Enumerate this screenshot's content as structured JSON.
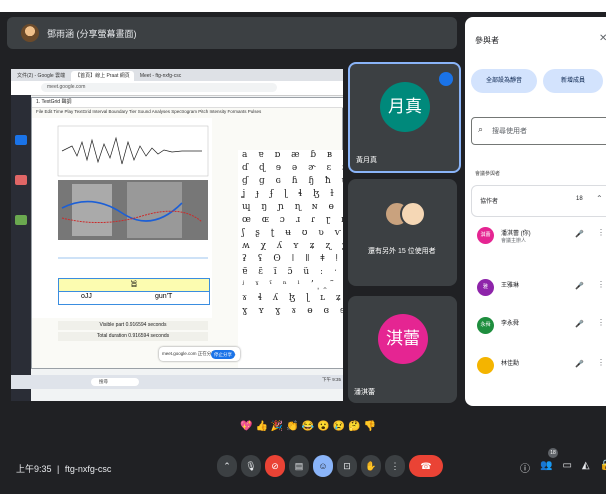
{
  "presenter": {
    "name": "鄧雨涵 (分享螢幕畫面)"
  },
  "shared_screen": {
    "browser_tabs": [
      "文件(2) - Google 雲端",
      "【首頁】線上 Praat 網頁",
      "Meet - ftg-nxfg-csc"
    ],
    "url": "meet.google.com",
    "praat_title": "1. TextGrid 聲調",
    "praat_menu": "File Edit Time Play TextGrid Interval Boundary Tier Sound Analyses Spectrogram Pitch Intensity Formants Pulses",
    "tier1_text": "旨",
    "tier2_left": "oJJ",
    "tier2_right": "gun'T",
    "visible_part": "Visible part 0.916594 seconds",
    "total_duration": "Total duration 0.916594 seconds",
    "ipa_rows": [
      "a ɐ ɒ æ ɓ ʙ ç ɕ ð",
      "ɗ ɖ ɘ ə ɚ ɛ ɜ ɟ ʄ",
      "ɠ ɡ ɢ ɦ ɧ ħ ɥ ɪ ɨ",
      "ʝ ɟ ʄ ɭ ɬ ɮ ɫ ɱ ɯ",
      "ɰ ŋ ɲ ɳ ɴ ɵ ø ɸ θ",
      "œ ɶ ɔ ɹ ɾ ɽ ʀ ʁ ɻ",
      "ʃ ʂ ʈ ʉ ʊ ʋ ⱱ ʌ ɣ",
      "ʍ χ ʎ ʏ ʑ ʐ ʒ ʔ ʕ",
      "ʡ ʢ ʘ ǀ ǁ ǂ ǃ ˈ ˌ",
      "ɐ̃ ɛ̃ ĩ ɔ̃ ũ ː ˑ ʰ ʷ",
      "ʲ ˠ ˤ ⁿ ˡ ʼ ̩ ̯ ̃",
      "ɤ ɬ ʎ ɮ ɭ ʟ ʑ ʐ ʒ",
      "ɣ ʏ ɣ ɤ ɵ ɞ ɘ ɕ ɟ"
    ],
    "share_notice": "meet.google.com 正在分享你的畫面。",
    "stop_share_label": "停止分享",
    "taskbar_search": "搜尋",
    "taskbar_time": "下午 9:35"
  },
  "tiles": [
    {
      "name": "黃月真",
      "avatar_text": "月真",
      "avatar_color": "#00897b"
    },
    {
      "name": "還有另外 15 位使用者"
    },
    {
      "name": "潘淇蕾",
      "avatar_text": "淇蕾",
      "avatar_color": "#e52592"
    }
  ],
  "panel": {
    "title": "參與者",
    "close_icon": "✕",
    "mute_all_label": "全部設為靜音",
    "add_people_label": "新增成員",
    "search_placeholder": "搜尋使用者",
    "in_meeting_label": "會議參與者",
    "collab_label": "協作者",
    "collab_count": "18",
    "participants": [
      {
        "name": "潘淇蕾 (你)",
        "sub": "會議主辦人",
        "avatar_text": "淇蕾",
        "color": "#e52592"
      },
      {
        "name": "王雅琳",
        "sub": "",
        "avatar_text": "雅",
        "color": "#8e24aa"
      },
      {
        "name": "李永舜",
        "sub": "",
        "avatar_text": "永舜",
        "color": "#1e8e3e"
      },
      {
        "name": "林佳勳",
        "sub": "",
        "avatar_text": "",
        "color": "#f4b400"
      }
    ]
  },
  "reactions": [
    "💖",
    "👍",
    "🎉",
    "👏",
    "😂",
    "😮",
    "😢",
    "🤔",
    "👎"
  ],
  "bottom": {
    "time": "上午9:35",
    "meeting_code": "ftg-nxfg-csc",
    "participant_count": "18"
  }
}
